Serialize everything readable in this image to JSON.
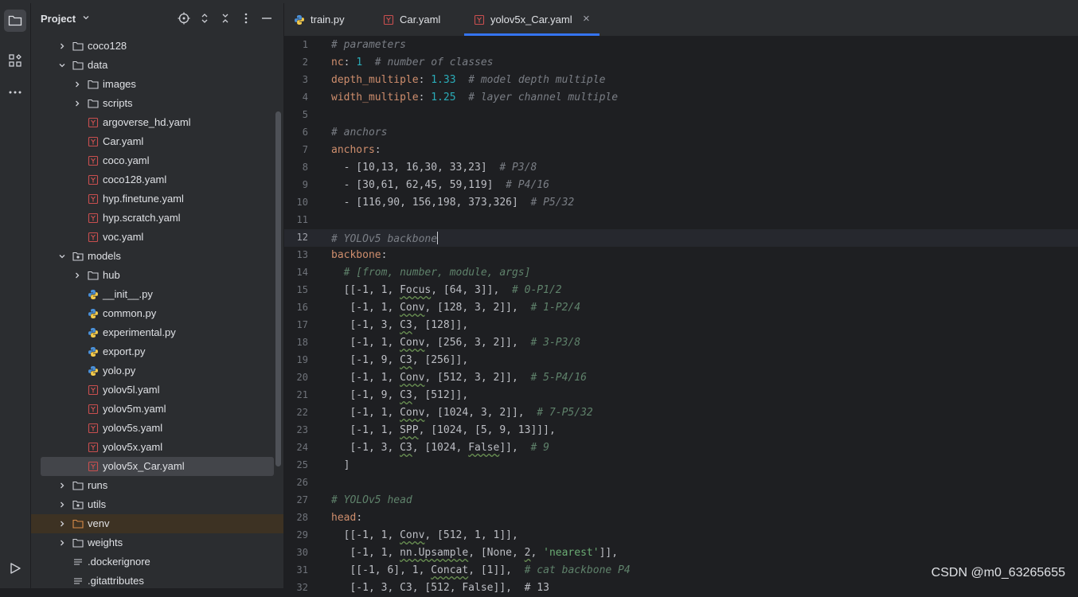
{
  "project": {
    "title": "Project",
    "tree": [
      {
        "label": "coco128",
        "kind": "folder",
        "depth": 1,
        "expanded": false
      },
      {
        "label": "data",
        "kind": "folder",
        "depth": 1,
        "expanded": true
      },
      {
        "label": "images",
        "kind": "folder",
        "depth": 2,
        "expanded": false
      },
      {
        "label": "scripts",
        "kind": "folder",
        "depth": 2,
        "expanded": false
      },
      {
        "label": "argoverse_hd.yaml",
        "kind": "yaml",
        "depth": 2
      },
      {
        "label": "Car.yaml",
        "kind": "yaml",
        "depth": 2
      },
      {
        "label": "coco.yaml",
        "kind": "yaml",
        "depth": 2
      },
      {
        "label": "coco128.yaml",
        "kind": "yaml",
        "depth": 2
      },
      {
        "label": "hyp.finetune.yaml",
        "kind": "yaml",
        "depth": 2
      },
      {
        "label": "hyp.scratch.yaml",
        "kind": "yaml",
        "depth": 2
      },
      {
        "label": "voc.yaml",
        "kind": "yaml",
        "depth": 2
      },
      {
        "label": "models",
        "kind": "package",
        "depth": 1,
        "expanded": true
      },
      {
        "label": "hub",
        "kind": "folder",
        "depth": 2,
        "expanded": false
      },
      {
        "label": "__init__.py",
        "kind": "python",
        "depth": 2
      },
      {
        "label": "common.py",
        "kind": "python",
        "depth": 2
      },
      {
        "label": "experimental.py",
        "kind": "python",
        "depth": 2
      },
      {
        "label": "export.py",
        "kind": "python",
        "depth": 2
      },
      {
        "label": "yolo.py",
        "kind": "python",
        "depth": 2
      },
      {
        "label": "yolov5l.yaml",
        "kind": "yaml",
        "depth": 2
      },
      {
        "label": "yolov5m.yaml",
        "kind": "yaml",
        "depth": 2
      },
      {
        "label": "yolov5s.yaml",
        "kind": "yaml",
        "depth": 2
      },
      {
        "label": "yolov5x.yaml",
        "kind": "yaml",
        "depth": 2
      },
      {
        "label": "yolov5x_Car.yaml",
        "kind": "yaml",
        "depth": 2,
        "selected": true
      },
      {
        "label": "runs",
        "kind": "folder",
        "depth": 1,
        "expanded": false
      },
      {
        "label": "utils",
        "kind": "package",
        "depth": 1,
        "expanded": false
      },
      {
        "label": "venv",
        "kind": "excluded",
        "depth": 1,
        "expanded": false
      },
      {
        "label": "weights",
        "kind": "folder",
        "depth": 1,
        "expanded": false
      },
      {
        "label": ".dockerignore",
        "kind": "text",
        "depth": 1
      },
      {
        "label": ".gitattributes",
        "kind": "text",
        "depth": 1
      }
    ]
  },
  "tabs": [
    {
      "label": "train.py",
      "kind": "python",
      "active": false
    },
    {
      "label": "Car.yaml",
      "kind": "yaml",
      "active": false
    },
    {
      "label": "yolov5x_Car.yaml",
      "kind": "yaml",
      "active": true
    }
  ],
  "tab_close_glyph": "×",
  "editor": {
    "current_line": 12,
    "lines": [
      [
        [
          "c",
          "# parameters"
        ]
      ],
      [
        [
          "k",
          "nc"
        ],
        [
          "p",
          ": "
        ],
        [
          "n",
          "1"
        ],
        [
          "p",
          "  "
        ],
        [
          "c",
          "# number of classes"
        ]
      ],
      [
        [
          "k",
          "depth_multiple"
        ],
        [
          "p",
          ": "
        ],
        [
          "n",
          "1.33"
        ],
        [
          "p",
          "  "
        ],
        [
          "c",
          "# model depth multiple"
        ]
      ],
      [
        [
          "k",
          "width_multiple"
        ],
        [
          "p",
          ": "
        ],
        [
          "n",
          "1.25"
        ],
        [
          "p",
          "  "
        ],
        [
          "c",
          "# layer channel multiple"
        ]
      ],
      [],
      [
        [
          "c",
          "# anchors"
        ]
      ],
      [
        [
          "k",
          "anchors"
        ],
        [
          "p",
          ":"
        ]
      ],
      [
        [
          "p",
          "  - [10,13, 16,30, 33,23]  "
        ],
        [
          "c",
          "# P3/8"
        ]
      ],
      [
        [
          "p",
          "  - [30,61, 62,45, 59,119]  "
        ],
        [
          "c",
          "# P4/16"
        ]
      ],
      [
        [
          "p",
          "  - [116,90, 156,198, 373,326]  "
        ],
        [
          "c",
          "# P5/32"
        ]
      ],
      [],
      [
        [
          "c",
          "# YOLOv5 backbone"
        ],
        [
          "caret",
          ""
        ]
      ],
      [
        [
          "k",
          "backbone"
        ],
        [
          "p",
          ":"
        ]
      ],
      [
        [
          "p",
          "  "
        ],
        [
          "c2",
          "# [from, number, module, args]"
        ]
      ],
      [
        [
          "p",
          "  [[-1, 1, "
        ],
        [
          "w",
          "Focus"
        ],
        [
          "p",
          ", [64, 3]],  "
        ],
        [
          "c2",
          "# 0-P1/2"
        ]
      ],
      [
        [
          "p",
          "   [-1, 1, "
        ],
        [
          "w",
          "Conv"
        ],
        [
          "p",
          ", [128, 3, 2]],  "
        ],
        [
          "c2",
          "# 1-P2/4"
        ]
      ],
      [
        [
          "p",
          "   [-1, 3, "
        ],
        [
          "w",
          "C3"
        ],
        [
          "p",
          ", [128]],"
        ]
      ],
      [
        [
          "p",
          "   [-1, 1, "
        ],
        [
          "w",
          "Conv"
        ],
        [
          "p",
          ", [256, 3, 2]],  "
        ],
        [
          "c2",
          "# 3-P3/8"
        ]
      ],
      [
        [
          "p",
          "   [-1, 9, "
        ],
        [
          "w",
          "C3"
        ],
        [
          "p",
          ", [256]],"
        ]
      ],
      [
        [
          "p",
          "   [-1, 1, "
        ],
        [
          "w",
          "Conv"
        ],
        [
          "p",
          ", [512, 3, 2]],  "
        ],
        [
          "c2",
          "# 5-P4/16"
        ]
      ],
      [
        [
          "p",
          "   [-1, 9, "
        ],
        [
          "w",
          "C3"
        ],
        [
          "p",
          ", [512]],"
        ]
      ],
      [
        [
          "p",
          "   [-1, 1, "
        ],
        [
          "w",
          "Conv"
        ],
        [
          "p",
          ", [1024, 3, 2]],  "
        ],
        [
          "c2",
          "# 7-P5/32"
        ]
      ],
      [
        [
          "p",
          "   [-1, 1, "
        ],
        [
          "w",
          "SPP"
        ],
        [
          "p",
          ", [1024, [5, 9, 13]]],"
        ]
      ],
      [
        [
          "p",
          "   [-1, 3, "
        ],
        [
          "w",
          "C3"
        ],
        [
          "p",
          ", [1024, "
        ],
        [
          "w",
          "False"
        ],
        [
          "p",
          "]],  "
        ],
        [
          "c2",
          "# 9"
        ]
      ],
      [
        [
          "p",
          "  ]"
        ]
      ],
      [],
      [
        [
          "c2",
          "# YOLOv5 head"
        ]
      ],
      [
        [
          "k",
          "head"
        ],
        [
          "p",
          ":"
        ]
      ],
      [
        [
          "p",
          "  [[-1, 1, "
        ],
        [
          "w",
          "Conv"
        ],
        [
          "p",
          ", [512, 1, 1]],"
        ]
      ],
      [
        [
          "p",
          "   [-1, 1, "
        ],
        [
          "w",
          "nn.Upsample"
        ],
        [
          "p",
          ", [None, "
        ],
        [
          "w",
          "2"
        ],
        [
          "p",
          ", "
        ],
        [
          "s",
          "'nearest'"
        ],
        [
          "p",
          "]],"
        ]
      ],
      [
        [
          "p",
          "   [[-1, 6], 1, "
        ],
        [
          "w",
          "Concat"
        ],
        [
          "p",
          ", [1]],  "
        ],
        [
          "c2",
          "# cat backbone P4"
        ]
      ],
      [
        [
          "p",
          "   [-1, 3, C3, [512, False]],  # 13"
        ]
      ]
    ]
  },
  "watermark": "CSDN @m0_63265655",
  "colors": {
    "accent": "#3574f0",
    "keyword": "#cf8e6d",
    "comment": "#7a7e85",
    "number": "#2aacb8",
    "yaml_icon": "#c94f4f",
    "folder_icon": "#ced0d6"
  }
}
